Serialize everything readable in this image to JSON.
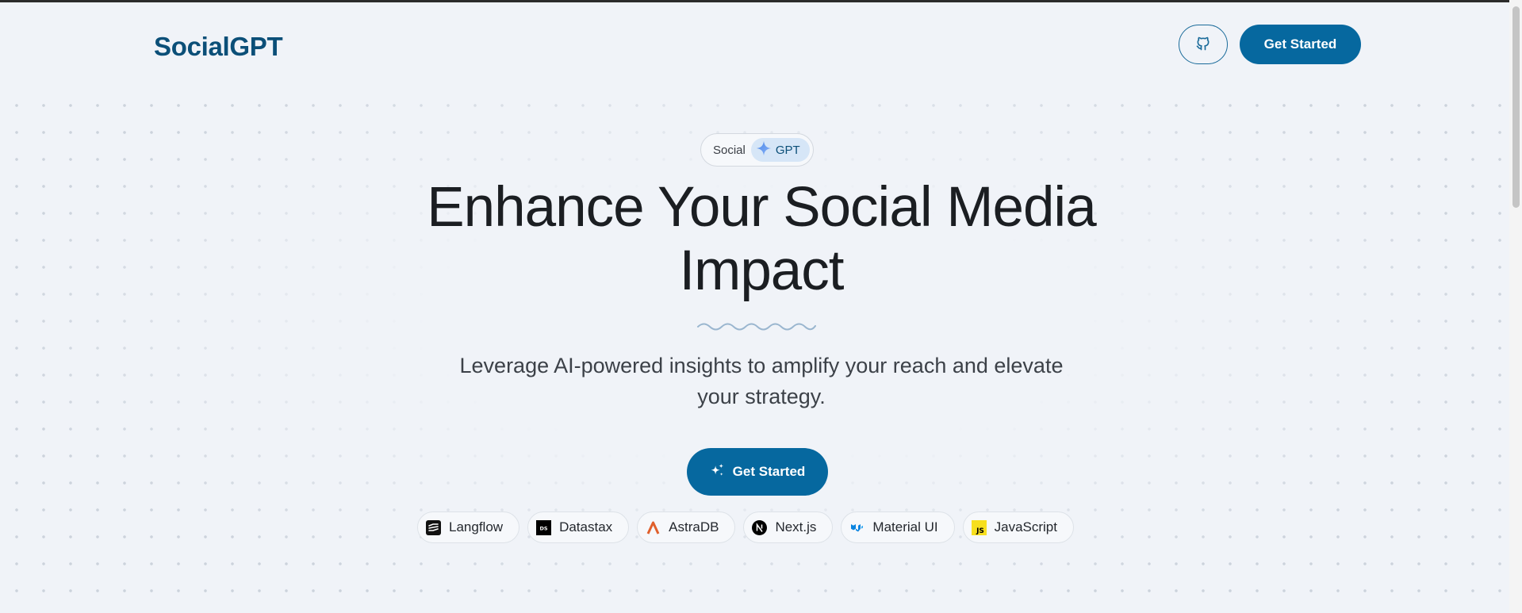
{
  "header": {
    "logo": "SocialGPT",
    "github_icon": "github-icon",
    "cta_label": "Get Started"
  },
  "badge": {
    "text": "Social",
    "pill_icon": "sparkle-icon",
    "pill_text": "GPT"
  },
  "hero": {
    "headline_line1": "Enhance Your Social Media",
    "headline_line2": "Impact",
    "subtitle_line1": "Leverage AI-powered insights to amplify your reach and elevate",
    "subtitle_line2": "your strategy.",
    "cta_icon": "sparkles-icon",
    "cta_label": "Get Started"
  },
  "tech": [
    {
      "label": "Langflow",
      "icon": "langflow-icon"
    },
    {
      "label": "Datastax",
      "icon": "datastax-icon"
    },
    {
      "label": "AstraDB",
      "icon": "astradb-icon"
    },
    {
      "label": "Next.js",
      "icon": "nextjs-icon"
    },
    {
      "label": "Material UI",
      "icon": "material-ui-icon"
    },
    {
      "label": "JavaScript",
      "icon": "javascript-icon"
    }
  ],
  "colors": {
    "brand": "#06689f",
    "logo": "#0b4f78",
    "background": "#f0f3f8"
  }
}
